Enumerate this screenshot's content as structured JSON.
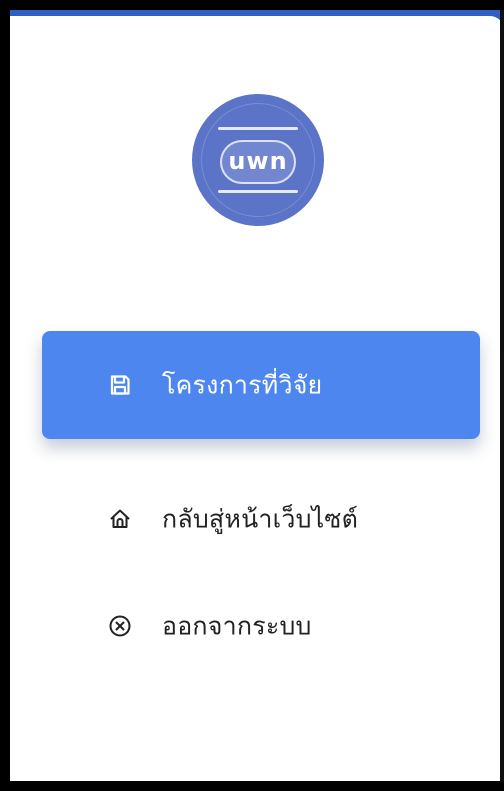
{
  "logo": {
    "text": "uwn"
  },
  "navigation": {
    "items": [
      {
        "label": "โครงการที่วิจัย",
        "icon": "save-icon",
        "active": true
      },
      {
        "label": "กลับสู่หน้าเว็บไซต์",
        "icon": "home-icon",
        "active": false
      },
      {
        "label": "ออกจากระบบ",
        "icon": "close-circle-icon",
        "active": false
      }
    ]
  },
  "colors": {
    "accent": "#4e86f0",
    "logo_background": "#5b74c7",
    "text": "#222222",
    "background": "#ffffff"
  }
}
